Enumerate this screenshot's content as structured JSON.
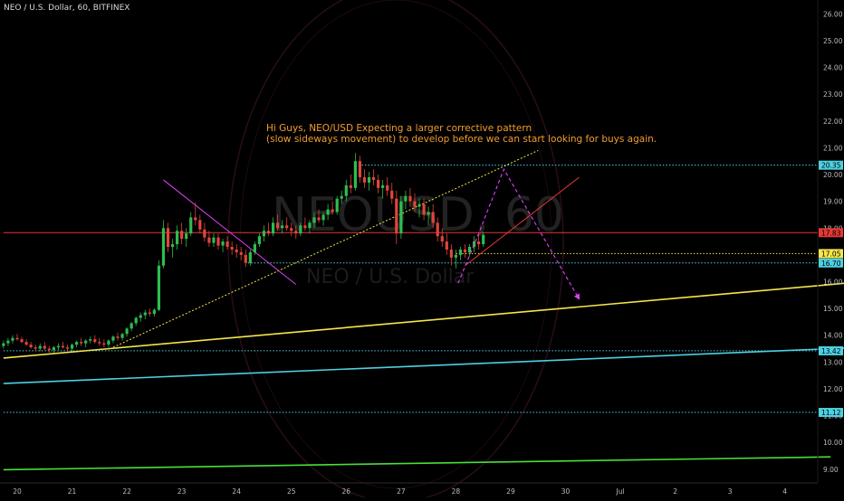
{
  "header": {
    "symbol": "NEO / U.S. Dollar, 60, BITFINEX"
  },
  "annotation": {
    "line1": "Hi Guys, NEO/USD Expecting a larger corrective pattern",
    "line2": "(slow sideways movement) to develop before we can start looking for buys again."
  },
  "watermark": {
    "ticker": "NEOUSD, 60",
    "name": "NEO / U.S. Dollar"
  },
  "colors": {
    "background": "#000000",
    "up_candle": "#2ebd4f",
    "down_candle": "#e2453c",
    "red_level": "#e53935",
    "yellow": "#f5e64a",
    "cyan": "#4dd0e1",
    "green": "#48e03a",
    "magenta": "#e040fb",
    "annotation": "#f39c2f"
  },
  "chart_data": {
    "type": "candlestick",
    "title": "NEO / U.S. Dollar, 60, BITFINEX",
    "y_axis": {
      "range": [
        8.8,
        26.3
      ],
      "ticks": [
        "9.00",
        "10.00",
        "11.00",
        "12.00",
        "13.00",
        "14.00",
        "15.00",
        "16.00",
        "17.00",
        "18.00",
        "19.00",
        "20.00",
        "21.00",
        "22.00",
        "23.00",
        "24.00",
        "25.00",
        "26.00"
      ]
    },
    "x_axis": {
      "ticks": [
        "20",
        "21",
        "22",
        "23",
        "24",
        "25",
        "26",
        "27",
        "28",
        "29",
        "30",
        "Jul",
        "2",
        "3",
        "4"
      ],
      "tick_dates": [
        "2018-06-20",
        "2018-06-21",
        "2018-06-22",
        "2018-06-23",
        "2018-06-24",
        "2018-06-25",
        "2018-06-26",
        "2018-06-27",
        "2018-06-28",
        "2018-06-29",
        "2018-06-30",
        "2018-07-01",
        "2018-07-02",
        "2018-07-03",
        "2018-07-04"
      ]
    },
    "price_tags": [
      {
        "value": "20.35",
        "color": "#4dd0e1"
      },
      {
        "value": "17.83",
        "color": "#e53935"
      },
      {
        "value": "17.05",
        "color": "#f5e64a"
      },
      {
        "value": "16.70",
        "color": "#4dd0e1"
      },
      {
        "value": "13.42",
        "color": "#4dd0e1"
      },
      {
        "value": "11.12",
        "color": "#4dd0e1"
      }
    ],
    "horizontal_levels": [
      {
        "price": 20.35,
        "color": "#4dd0e1",
        "style": "dotted",
        "from": "2018-06-26T04:00"
      },
      {
        "price": 17.83,
        "color": "#e53935",
        "style": "solid",
        "from": "2018-06-19T18:00"
      },
      {
        "price": 17.05,
        "color": "#f5e64a",
        "style": "dotted",
        "from": "2018-06-28T00:00"
      },
      {
        "price": 16.7,
        "color": "#4dd0e1",
        "style": "dotted",
        "from": "2018-06-24T05:00"
      },
      {
        "price": 13.42,
        "color": "#4dd0e1",
        "style": "dotted",
        "from": "2018-06-19T18:00"
      },
      {
        "price": 11.12,
        "color": "#4dd0e1",
        "style": "dotted",
        "from": "2018-06-19T18:00"
      }
    ],
    "trendlines": [
      {
        "name": "yellow support",
        "color": "#f5e64a",
        "points": [
          [
            "2018-06-19T18:00",
            13.15
          ],
          [
            "2018-07-05T10:00",
            16.0
          ]
        ]
      },
      {
        "name": "cyan support",
        "color": "#4dd0e1",
        "points": [
          [
            "2018-06-19T18:00",
            12.2
          ],
          [
            "2018-07-05T10:00",
            13.55
          ]
        ]
      },
      {
        "name": "green support",
        "color": "#48e03a",
        "points": [
          [
            "2018-06-19T18:00",
            8.98
          ],
          [
            "2018-07-04T20:00",
            9.46
          ]
        ]
      },
      {
        "name": "yellow dotted rising",
        "color": "#f5e64a",
        "dotted": true,
        "points": [
          [
            "2018-06-21T18:00",
            13.55
          ],
          [
            "2018-06-29T12:00",
            20.9
          ]
        ]
      },
      {
        "name": "magenta falling",
        "color": "#e040fb",
        "points": [
          [
            "2018-06-22T16:00",
            19.8
          ],
          [
            "2018-06-25T02:00",
            15.9
          ]
        ]
      },
      {
        "name": "channel upper",
        "color": "#e53935",
        "points": [
          [
            "2018-06-28T04:00",
            16.6
          ],
          [
            "2018-06-30T06:00",
            19.9
          ]
        ]
      }
    ],
    "projection_path": {
      "color": "#e040fb",
      "points": [
        [
          "2018-06-28T01:00",
          15.95
        ],
        [
          "2018-06-28T10:00",
          17.8
        ],
        [
          "2018-06-28T21:00",
          20.2
        ],
        [
          "2018-06-30T06:00",
          15.35
        ]
      ]
    },
    "candles_ohlc": [
      [
        "2018-06-19T18:00",
        13.6,
        13.8,
        13.5,
        13.7
      ],
      [
        "2018-06-19T20:00",
        13.7,
        13.9,
        13.6,
        13.8
      ],
      [
        "2018-06-19T22:00",
        13.8,
        14.0,
        13.7,
        13.9
      ],
      [
        "2018-06-20T00:00",
        13.9,
        14.05,
        13.8,
        13.85
      ],
      [
        "2018-06-20T02:00",
        13.85,
        13.95,
        13.7,
        13.75
      ],
      [
        "2018-06-20T04:00",
        13.75,
        13.85,
        13.6,
        13.65
      ],
      [
        "2018-06-20T06:00",
        13.65,
        13.75,
        13.5,
        13.55
      ],
      [
        "2018-06-20T08:00",
        13.55,
        13.65,
        13.4,
        13.5
      ],
      [
        "2018-06-20T10:00",
        13.5,
        13.7,
        13.4,
        13.6
      ],
      [
        "2018-06-20T12:00",
        13.6,
        13.75,
        13.45,
        13.5
      ],
      [
        "2018-06-20T14:00",
        13.5,
        13.6,
        13.35,
        13.45
      ],
      [
        "2018-06-20T16:00",
        13.45,
        13.6,
        13.35,
        13.55
      ],
      [
        "2018-06-20T18:00",
        13.55,
        13.7,
        13.45,
        13.6
      ],
      [
        "2018-06-20T20:00",
        13.6,
        13.75,
        13.5,
        13.55
      ],
      [
        "2018-06-20T22:00",
        13.55,
        13.65,
        13.4,
        13.5
      ],
      [
        "2018-06-21T00:00",
        13.5,
        13.7,
        13.4,
        13.65
      ],
      [
        "2018-06-21T02:00",
        13.65,
        13.8,
        13.55,
        13.75
      ],
      [
        "2018-06-21T04:00",
        13.75,
        13.9,
        13.6,
        13.7
      ],
      [
        "2018-06-21T06:00",
        13.7,
        13.85,
        13.55,
        13.8
      ],
      [
        "2018-06-21T08:00",
        13.8,
        13.95,
        13.7,
        13.85
      ],
      [
        "2018-06-21T10:00",
        13.85,
        14.0,
        13.7,
        13.75
      ],
      [
        "2018-06-21T12:00",
        13.75,
        13.9,
        13.6,
        13.7
      ],
      [
        "2018-06-21T14:00",
        13.7,
        13.85,
        13.55,
        13.65
      ],
      [
        "2018-06-21T16:00",
        13.65,
        13.85,
        13.55,
        13.8
      ],
      [
        "2018-06-21T18:00",
        13.8,
        14.0,
        13.7,
        13.95
      ],
      [
        "2018-06-21T20:00",
        13.95,
        14.1,
        13.8,
        13.9
      ],
      [
        "2018-06-21T22:00",
        13.9,
        14.1,
        13.8,
        14.05
      ],
      [
        "2018-06-22T00:00",
        14.05,
        14.3,
        13.95,
        14.25
      ],
      [
        "2018-06-22T02:00",
        14.25,
        14.5,
        14.15,
        14.45
      ],
      [
        "2018-06-22T04:00",
        14.45,
        14.7,
        14.35,
        14.65
      ],
      [
        "2018-06-22T06:00",
        14.65,
        14.85,
        14.5,
        14.75
      ],
      [
        "2018-06-22T08:00",
        14.75,
        14.95,
        14.6,
        14.85
      ],
      [
        "2018-06-22T10:00",
        14.85,
        15.0,
        14.7,
        14.8
      ],
      [
        "2018-06-22T12:00",
        14.8,
        15.0,
        14.7,
        14.95
      ],
      [
        "2018-06-22T14:00",
        14.95,
        16.8,
        14.9,
        16.6
      ],
      [
        "2018-06-22T16:00",
        16.6,
        18.3,
        16.5,
        18.0
      ],
      [
        "2018-06-22T18:00",
        18.0,
        18.2,
        17.1,
        17.3
      ],
      [
        "2018-06-22T20:00",
        17.3,
        17.6,
        16.9,
        17.4
      ],
      [
        "2018-06-22T22:00",
        17.4,
        18.1,
        17.2,
        17.9
      ],
      [
        "2018-06-23T00:00",
        17.9,
        18.2,
        17.4,
        17.6
      ],
      [
        "2018-06-23T02:00",
        17.6,
        18.0,
        17.3,
        17.8
      ],
      [
        "2018-06-23T04:00",
        17.8,
        18.6,
        17.7,
        18.4
      ],
      [
        "2018-06-23T06:00",
        18.4,
        18.95,
        18.1,
        18.3
      ],
      [
        "2018-06-23T08:00",
        18.3,
        18.5,
        17.8,
        17.95
      ],
      [
        "2018-06-23T10:00",
        17.95,
        18.2,
        17.5,
        17.65
      ],
      [
        "2018-06-23T12:00",
        17.65,
        17.9,
        17.3,
        17.45
      ],
      [
        "2018-06-23T14:00",
        17.45,
        17.8,
        17.3,
        17.65
      ],
      [
        "2018-06-23T16:00",
        17.65,
        17.8,
        17.2,
        17.35
      ],
      [
        "2018-06-23T18:00",
        17.35,
        17.6,
        17.1,
        17.5
      ],
      [
        "2018-06-23T20:00",
        17.5,
        17.7,
        17.2,
        17.3
      ],
      [
        "2018-06-23T22:00",
        17.3,
        17.5,
        17.0,
        17.2
      ],
      [
        "2018-06-24T00:00",
        17.2,
        17.4,
        16.9,
        17.1
      ],
      [
        "2018-06-24T02:00",
        17.1,
        17.3,
        16.8,
        17.0
      ],
      [
        "2018-06-24T04:00",
        17.0,
        17.2,
        16.55,
        16.7
      ],
      [
        "2018-06-24T06:00",
        16.7,
        17.2,
        16.6,
        17.1
      ],
      [
        "2018-06-24T08:00",
        17.1,
        17.5,
        17.0,
        17.4
      ],
      [
        "2018-06-24T10:00",
        17.4,
        17.8,
        17.3,
        17.7
      ],
      [
        "2018-06-24T12:00",
        17.7,
        18.1,
        17.5,
        17.9
      ],
      [
        "2018-06-24T14:00",
        17.9,
        18.2,
        17.7,
        17.8
      ],
      [
        "2018-06-24T16:00",
        17.8,
        18.4,
        17.7,
        18.2
      ],
      [
        "2018-06-24T18:00",
        18.2,
        18.5,
        17.9,
        18.0
      ],
      [
        "2018-06-24T20:00",
        18.0,
        18.3,
        17.8,
        18.1
      ],
      [
        "2018-06-24T22:00",
        18.1,
        18.4,
        17.9,
        18.0
      ],
      [
        "2018-06-25T00:00",
        18.0,
        18.2,
        17.7,
        17.9
      ],
      [
        "2018-06-25T02:00",
        17.9,
        18.1,
        17.6,
        17.8
      ],
      [
        "2018-06-25T04:00",
        17.8,
        18.2,
        17.7,
        18.1
      ],
      [
        "2018-06-25T06:00",
        18.1,
        18.4,
        17.9,
        18.0
      ],
      [
        "2018-06-25T08:00",
        18.0,
        18.3,
        17.8,
        18.2
      ],
      [
        "2018-06-25T10:00",
        18.2,
        18.6,
        18.0,
        18.4
      ],
      [
        "2018-06-25T12:00",
        18.4,
        18.7,
        18.2,
        18.3
      ],
      [
        "2018-06-25T14:00",
        18.3,
        18.6,
        18.1,
        18.5
      ],
      [
        "2018-06-25T16:00",
        18.5,
        18.9,
        18.3,
        18.7
      ],
      [
        "2018-06-25T18:00",
        18.7,
        19.0,
        18.5,
        18.6
      ],
      [
        "2018-06-25T20:00",
        18.6,
        19.2,
        18.5,
        19.1
      ],
      [
        "2018-06-25T22:00",
        19.1,
        19.4,
        18.9,
        19.2
      ],
      [
        "2018-06-26T00:00",
        19.2,
        19.8,
        19.0,
        19.6
      ],
      [
        "2018-06-26T02:00",
        19.6,
        20.0,
        19.3,
        19.5
      ],
      [
        "2018-06-26T04:00",
        19.5,
        20.8,
        19.4,
        20.5
      ],
      [
        "2018-06-26T06:00",
        20.5,
        20.7,
        19.7,
        19.9
      ],
      [
        "2018-06-26T08:00",
        19.9,
        20.2,
        19.5,
        19.7
      ],
      [
        "2018-06-26T10:00",
        19.7,
        20.1,
        19.4,
        19.9
      ],
      [
        "2018-06-26T12:00",
        19.9,
        20.2,
        19.6,
        19.8
      ],
      [
        "2018-06-26T14:00",
        19.8,
        20.0,
        19.3,
        19.5
      ],
      [
        "2018-06-26T16:00",
        19.5,
        19.8,
        19.1,
        19.6
      ],
      [
        "2018-06-26T18:00",
        19.6,
        19.9,
        19.2,
        19.4
      ],
      [
        "2018-06-26T20:00",
        19.4,
        19.7,
        18.9,
        19.1
      ],
      [
        "2018-06-26T22:00",
        19.1,
        19.4,
        17.4,
        17.8
      ],
      [
        "2018-06-27T00:00",
        17.8,
        19.2,
        17.6,
        19.0
      ],
      [
        "2018-06-27T02:00",
        19.0,
        19.4,
        18.7,
        19.2
      ],
      [
        "2018-06-27T04:00",
        19.2,
        19.5,
        18.8,
        19.0
      ],
      [
        "2018-06-27T06:00",
        19.0,
        19.3,
        18.6,
        18.8
      ],
      [
        "2018-06-27T08:00",
        18.8,
        19.1,
        18.4,
        18.9
      ],
      [
        "2018-06-27T10:00",
        18.9,
        19.1,
        18.3,
        18.5
      ],
      [
        "2018-06-27T12:00",
        18.5,
        18.8,
        18.1,
        18.6
      ],
      [
        "2018-06-27T14:00",
        18.6,
        18.9,
        18.0,
        18.2
      ],
      [
        "2018-06-27T16:00",
        18.2,
        18.4,
        17.5,
        17.7
      ],
      [
        "2018-06-27T18:00",
        17.7,
        18.0,
        17.3,
        17.5
      ],
      [
        "2018-06-27T20:00",
        17.5,
        17.8,
        17.0,
        17.2
      ],
      [
        "2018-06-27T22:00",
        17.2,
        17.4,
        16.6,
        16.9
      ],
      [
        "2018-06-28T00:00",
        16.9,
        17.2,
        16.5,
        17.0
      ],
      [
        "2018-06-28T02:00",
        17.0,
        17.3,
        16.8,
        17.2
      ],
      [
        "2018-06-28T04:00",
        17.2,
        17.4,
        16.9,
        17.1
      ],
      [
        "2018-06-28T06:00",
        17.1,
        17.4,
        16.95,
        17.3
      ],
      [
        "2018-06-28T08:00",
        17.3,
        17.7,
        17.1,
        17.5
      ],
      [
        "2018-06-28T10:00",
        17.5,
        17.8,
        17.2,
        17.4
      ],
      [
        "2018-06-28T12:00",
        17.4,
        17.85,
        17.3,
        17.75
      ]
    ]
  }
}
